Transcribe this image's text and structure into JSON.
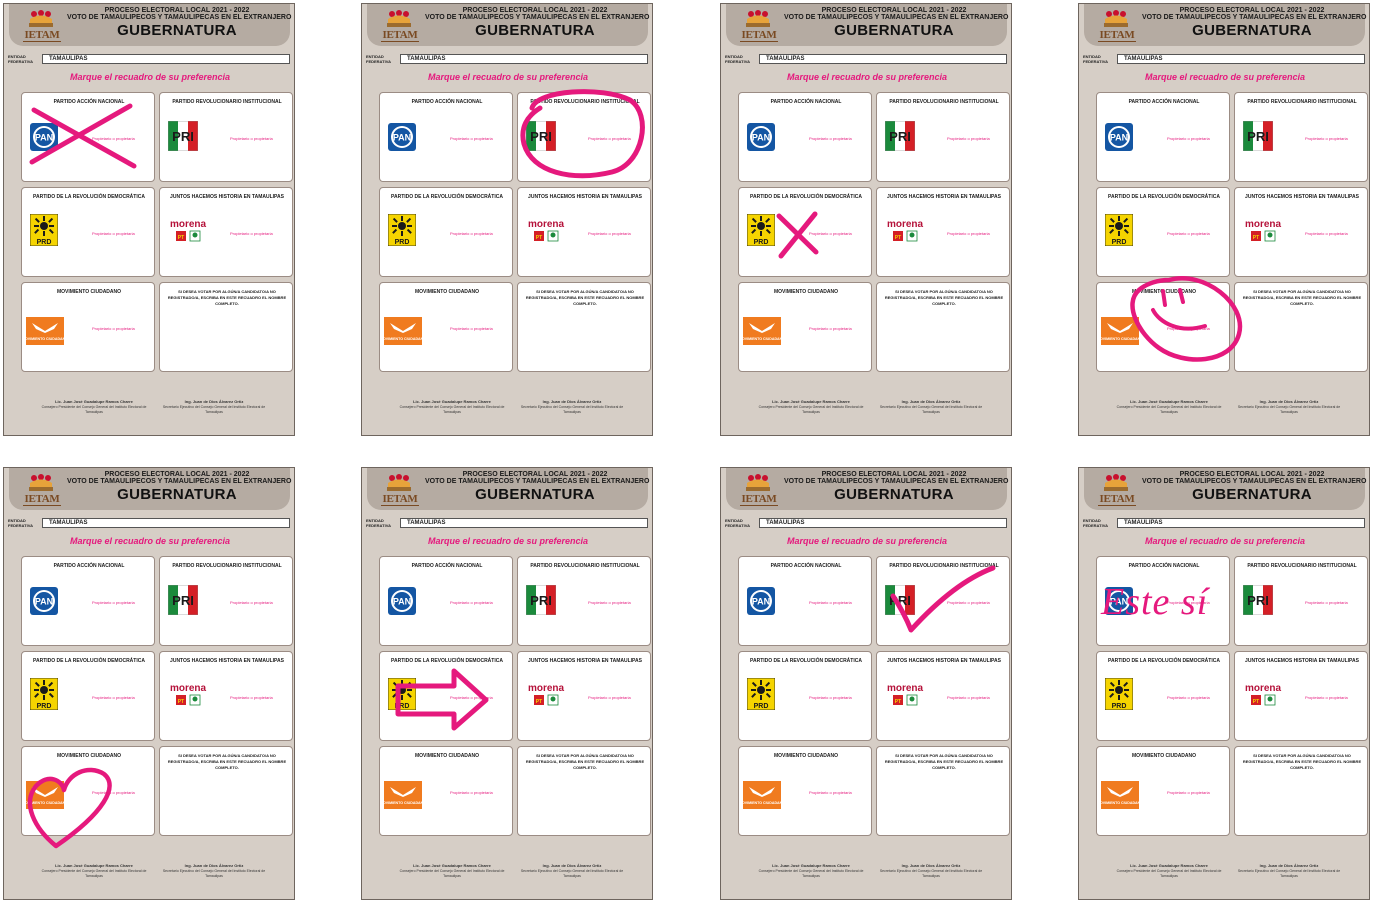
{
  "ballot": {
    "title_line1": "PROCESO ELECTORAL LOCAL 2021 - 2022",
    "title_line2": "VOTO DE TAMAULIPECOS Y TAMAULIPECAS EN EL EXTRANJERO",
    "title_main": "GUBERNATURA",
    "logo_text": "IETAM",
    "entity_label": "ENTIDAD FEDERATIVA",
    "entity_value": "TAMAULIPAS",
    "instruction": "Marque el recuadro de su preferencia",
    "parties": {
      "pan": {
        "name": "PARTIDO ACCIÓN NACIONAL",
        "logo": "PAN"
      },
      "pri": {
        "name": "PARTIDO REVOLUCIONARIO INSTITUCIONAL",
        "logo": "PRI"
      },
      "prd": {
        "name": "PARTIDO DE LA REVOLUCIÓN DEMOCRÁTICA",
        "logo": "PRD"
      },
      "morena": {
        "name": "JUNTOS HACEMOS HISTORIA EN TAMAULIPAS",
        "logo": "morena",
        "logo2": "PT",
        "logo3": "PVEM"
      },
      "mc": {
        "name": "MOVIMIENTO CIUDADANO",
        "logo": "MOVIMIENTO CIUDADANO"
      }
    },
    "candidate_placeholder": "Propietario o propietaria",
    "write_in": "SI DESEA VOTAR POR ALGÚN/A CANDIDATO/A NO REGISTRADO/A, ESCRIBA EN ESTE RECUADRO EL NOMBRE COMPLETO.",
    "signature1_name": "Lic. Juan José Guadalupe Ramos Charre",
    "signature1_role": "Consejero Presidente del Consejo General del Instituto Electoral de Tamaulipas",
    "signature2_name": "Ing. Juan de Dios Álvarez Ortiz",
    "signature2_role": "Secretario Ejecutivo del Consejo General del Instituto Electoral de Tamaulipas"
  },
  "marks": [
    "x-over-pan",
    "circle-over-pri",
    "x-over-prd",
    "smiley-over-mc",
    "heart-over-mc",
    "arrow-prd-to-morena",
    "check-over-pri",
    "text-over-pan"
  ],
  "mark_text": "Este sí",
  "colors": {
    "mark": "#e5197d",
    "frame": "#d6cec6",
    "header": "#b5aba2",
    "pan": "#1456a3",
    "prd": "#f5d400",
    "mc": "#f07b1f",
    "morena": "#b5123a",
    "pri_green": "#1b8a3c",
    "pri_red": "#d41f26"
  }
}
